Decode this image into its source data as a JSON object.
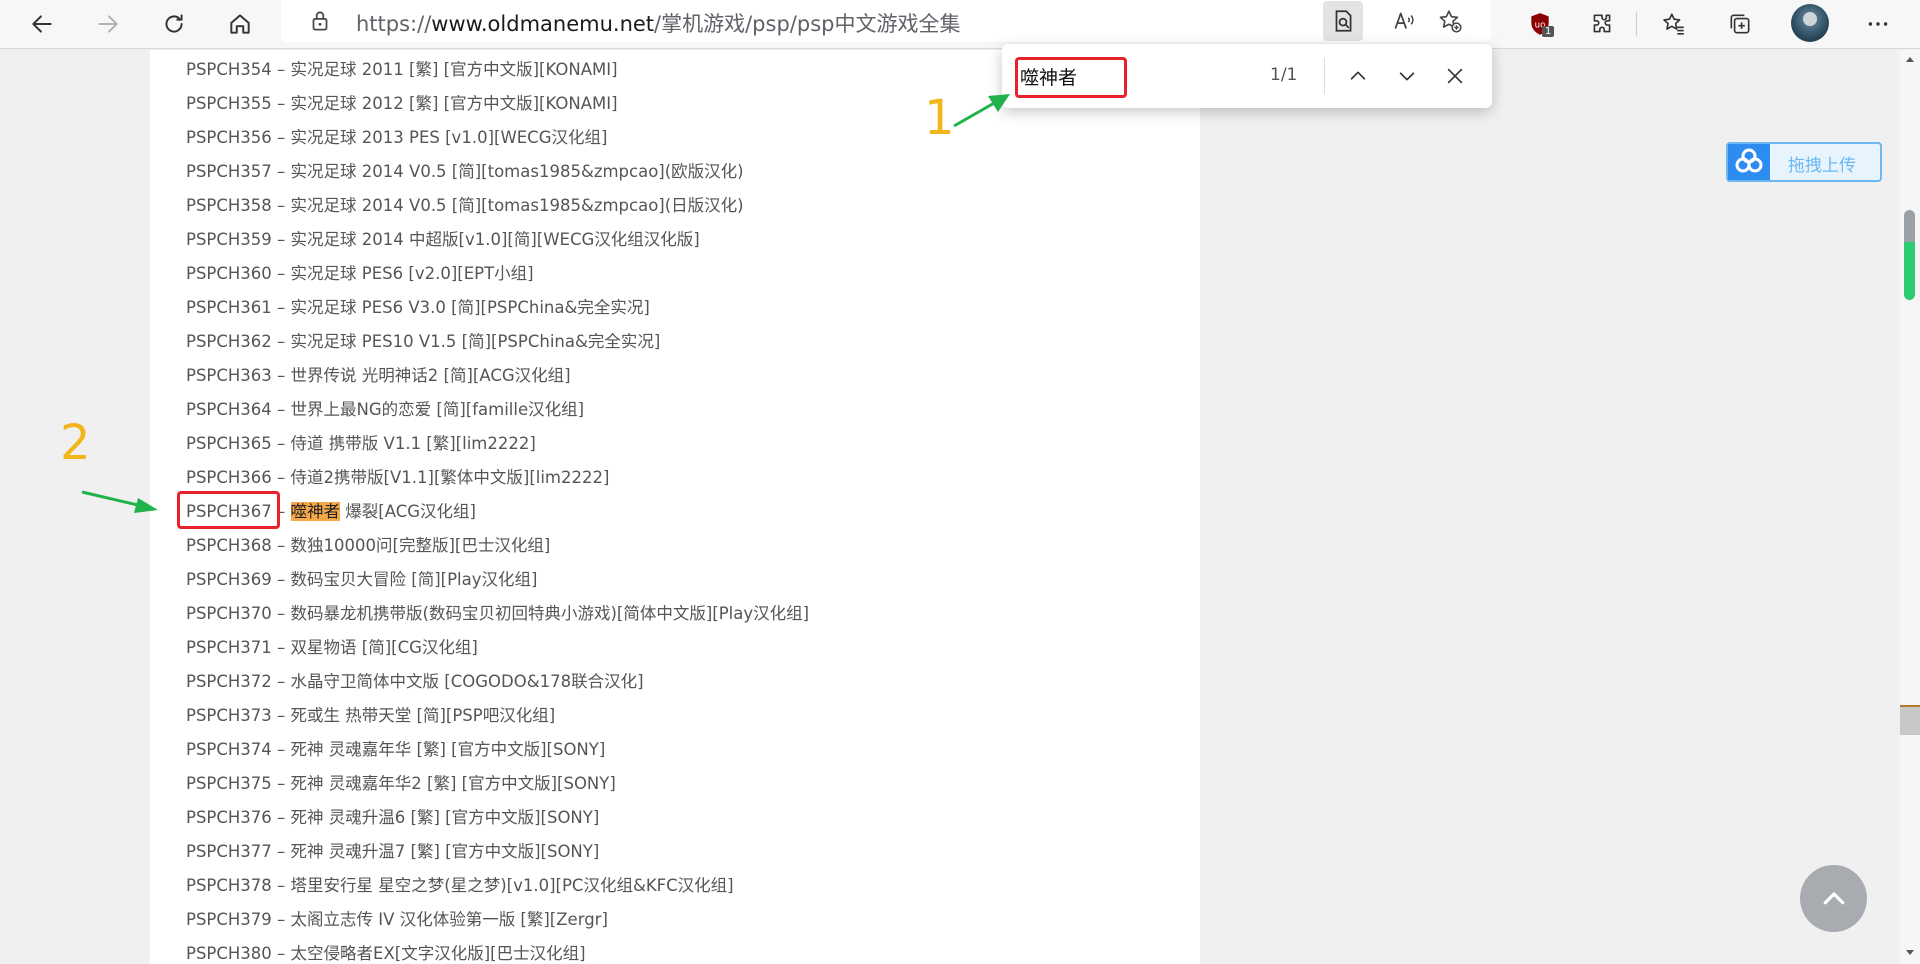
{
  "browser": {
    "url_prefix": "https://",
    "url_host": "www.oldmanemu.net",
    "url_path": "/掌机游戏/psp/psp中文游戏全集",
    "extension_badge": "1"
  },
  "find_bar": {
    "query": "噬神者",
    "count": "1/1"
  },
  "annotations": {
    "label_1": "1",
    "label_2": "2"
  },
  "upload_widget": {
    "label": "拖拽上传"
  },
  "game_list": [
    {
      "code": "PSPCH354",
      "title": "实况足球 2011 [繁] [官方中文版][KONAMI]"
    },
    {
      "code": "PSPCH355",
      "title": "实况足球 2012 [繁] [官方中文版][KONAMI]"
    },
    {
      "code": "PSPCH356",
      "title": "实况足球 2013 PES [v1.0][WECG汉化组]"
    },
    {
      "code": "PSPCH357",
      "title": "实况足球 2014 V0.5 [简][tomas1985&zmpcao](欧版汉化)"
    },
    {
      "code": "PSPCH358",
      "title": "实况足球 2014 V0.5 [简][tomas1985&zmpcao](日版汉化)"
    },
    {
      "code": "PSPCH359",
      "title": "实况足球 2014 中超版[v1.0][简][WECG汉化组汉化版]"
    },
    {
      "code": "PSPCH360",
      "title": "实况足球 PES6 [v2.0][EPT小组]"
    },
    {
      "code": "PSPCH361",
      "title": "实况足球 PES6 V3.0 [简][PSPChina&完全实况]"
    },
    {
      "code": "PSPCH362",
      "title": "实况足球 PES10 V1.5 [简][PSPChina&完全实况]"
    },
    {
      "code": "PSPCH363",
      "title": "世界传说 光明神话2 [简][ACG汉化组]"
    },
    {
      "code": "PSPCH364",
      "title": "世界上最NG的恋爱 [简][famille汉化组]"
    },
    {
      "code": "PSPCH365",
      "title": "侍道 携带版 V1.1 [繁][lim2222]"
    },
    {
      "code": "PSPCH366",
      "title": "侍道2携带版[V1.1][繁体中文版][lim2222]"
    },
    {
      "code": "PSPCH367",
      "title_highlight": "噬神者",
      "title_rest": " 爆裂[ACG汉化组]"
    },
    {
      "code": "PSPCH368",
      "title": "数独10000问[完整版][巴士汉化组]"
    },
    {
      "code": "PSPCH369",
      "title": "数码宝贝大冒险 [简][Play汉化组]"
    },
    {
      "code": "PSPCH370",
      "title": "数码暴龙机携带版(数码宝贝初回特典小游戏)[简体中文版][Play汉化组]"
    },
    {
      "code": "PSPCH371",
      "title": "双星物语 [简][CG汉化组]"
    },
    {
      "code": "PSPCH372",
      "title": "水晶守卫简体中文版 [COGODO&178联合汉化]"
    },
    {
      "code": "PSPCH373",
      "title": "死或生 热带天堂 [简][PSP吧汉化组]"
    },
    {
      "code": "PSPCH374",
      "title": "死神 灵魂嘉年华 [繁] [官方中文版][SONY]"
    },
    {
      "code": "PSPCH375",
      "title": "死神 灵魂嘉年华2 [繁] [官方中文版][SONY]"
    },
    {
      "code": "PSPCH376",
      "title": "死神 灵魂升温6 [繁] [官方中文版][SONY]"
    },
    {
      "code": "PSPCH377",
      "title": "死神 灵魂升温7 [繁] [官方中文版][SONY]"
    },
    {
      "code": "PSPCH378",
      "title": "塔里安行星 星空之梦(星之梦)[v1.0][PC汉化组&KFC汉化组]"
    },
    {
      "code": "PSPCH379",
      "title": "太阁立志传 IV 汉化体验第一版 [繁][Zergr]"
    },
    {
      "code": "PSPCH380",
      "title": "太空侵略者EX[文字汉化版][巴士汉化组]"
    }
  ],
  "separator": " – "
}
